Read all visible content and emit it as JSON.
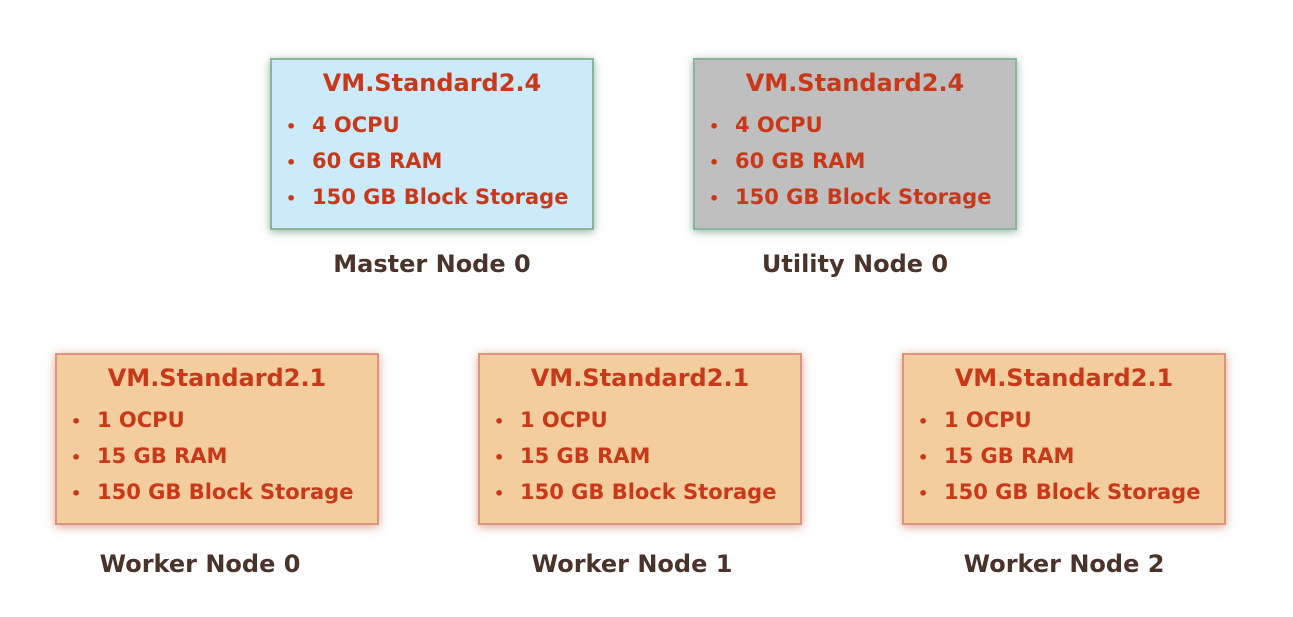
{
  "nodes": {
    "master0": {
      "shape": "VM.Standard2.4",
      "specs": [
        "4 OCPU",
        "60 GB RAM",
        "150 GB Block Storage"
      ],
      "label": "Master Node 0"
    },
    "utility0": {
      "shape": "VM.Standard2.4",
      "specs": [
        "4 OCPU",
        "60 GB RAM",
        "150 GB Block Storage"
      ],
      "label": "Utility Node 0"
    },
    "worker0": {
      "shape": "VM.Standard2.1",
      "specs": [
        "1 OCPU",
        "15 GB RAM",
        "150 GB Block Storage"
      ],
      "label": "Worker Node 0"
    },
    "worker1": {
      "shape": "VM.Standard2.1",
      "specs": [
        "1 OCPU",
        "15 GB RAM",
        "150 GB Block Storage"
      ],
      "label": "Worker Node 1"
    },
    "worker2": {
      "shape": "VM.Standard2.1",
      "specs": [
        "1 OCPU",
        "15 GB RAM",
        "150 GB Block Storage"
      ],
      "label": "Worker Node 2"
    }
  },
  "bullet_glyph": "•",
  "colors": {
    "spec_text": "#c8391a",
    "label_text": "#4a3328",
    "master_fill": "#cdeafb",
    "utility_fill": "#bfbfbf",
    "worker_fill": "#f3cd9d"
  }
}
